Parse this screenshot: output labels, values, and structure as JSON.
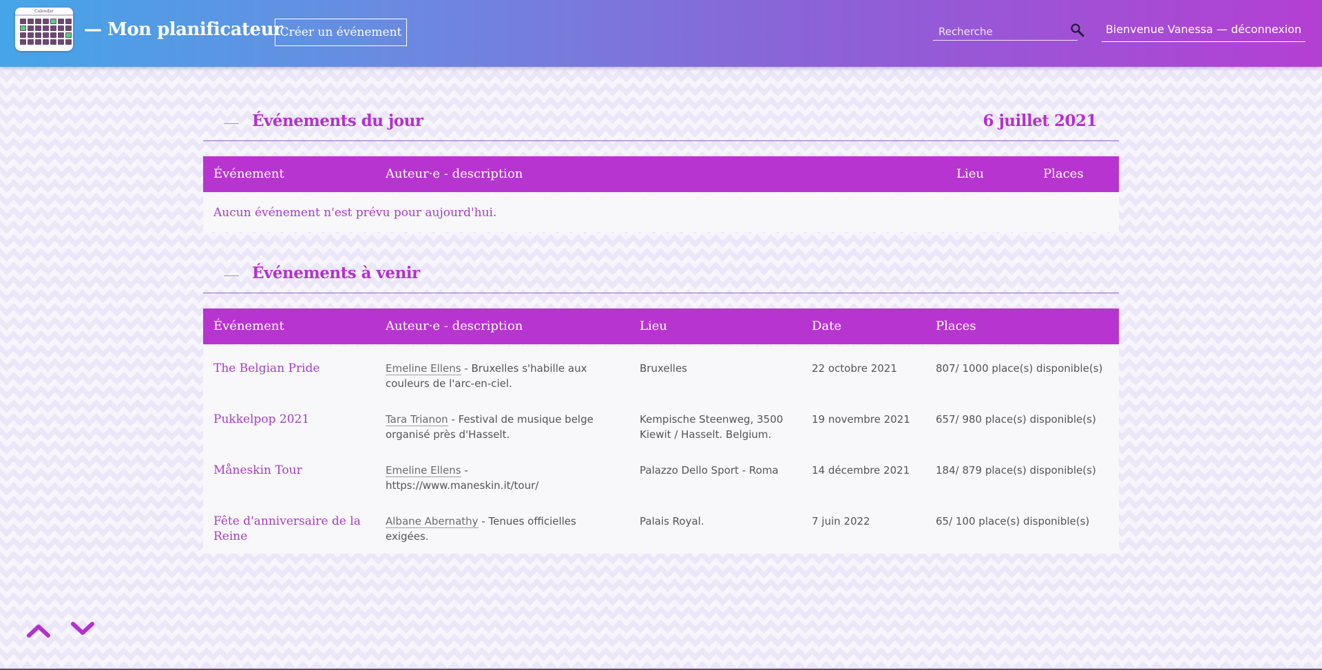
{
  "header": {
    "logo_caption": "Calendar",
    "brand": "— Mon planificateur",
    "create_button": "Créer un événement",
    "search_placeholder": "Recherche",
    "welcome": "Bienvenue Vanessa — déconnexion",
    "icons": {
      "search": "magnifier-icon",
      "logo": "calendar-logo-icon"
    }
  },
  "today": {
    "title": "Événements du jour",
    "date": "6 juillet 2021",
    "columns": [
      "Événement",
      "Auteur·e - description",
      "Lieu",
      "Places"
    ],
    "empty_message": "Aucun événement n'est prévu pour aujourd'hui."
  },
  "upcoming": {
    "title": "Événements à venir",
    "columns": [
      "Événement",
      "Auteur·e - description",
      "Lieu",
      "Date",
      "Places"
    ],
    "rows": [
      {
        "name": "The Belgian Pride",
        "author": "Emeline Ellens",
        "description": " - Bruxelles s'habille aux couleurs de l'arc-en-ciel.",
        "place": "Bruxelles",
        "date": "22 octobre 2021",
        "seats": "807/ 1000 place(s) disponible(s)"
      },
      {
        "name": "Pukkelpop 2021",
        "author": "Tara Trianon",
        "description": " - Festival de musique belge organisé près d'Hasselt.",
        "place": "Kempische Steenweg, 3500 Kiewit / Hasselt. Belgium.",
        "date": "19 novembre 2021",
        "seats": "657/ 980 place(s) disponible(s)"
      },
      {
        "name": "Måneskin Tour",
        "author": "Emeline Ellens",
        "description": " - https://www.maneskin.it/tour/",
        "place": "Palazzo Dello Sport - Roma",
        "date": "14 décembre 2021",
        "seats": "184/ 879 place(s) disponible(s)"
      },
      {
        "name": "Fête d'anniversaire de la Reine",
        "author": "Albane Abernathy",
        "description": " - Tenues officielles exigées.",
        "place": "Palais Royal.",
        "date": "7 juin 2022",
        "seats": "65/ 100 place(s) disponible(s)"
      }
    ]
  },
  "nav": {
    "up_icon": "chevron-up-icon",
    "down_icon": "chevron-down-icon"
  },
  "colors": {
    "accent": "#b834d1",
    "header_start": "#45a5e8",
    "header_end": "#b43fd3"
  }
}
